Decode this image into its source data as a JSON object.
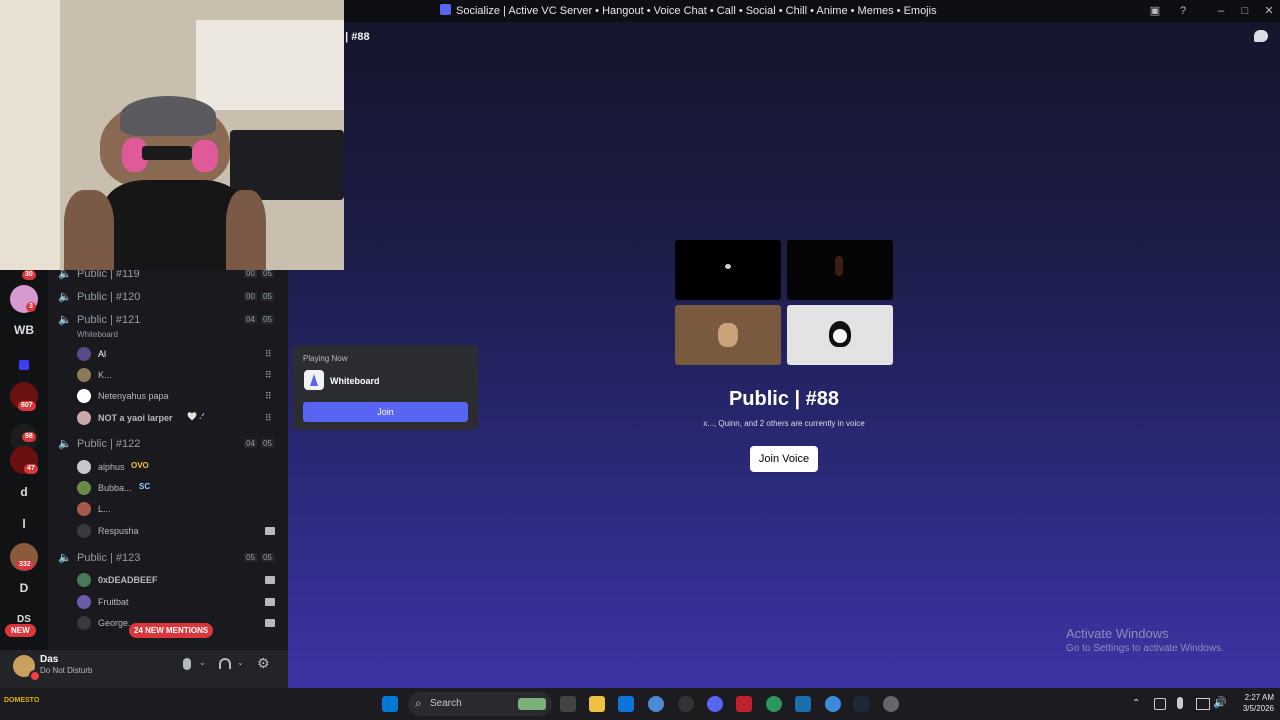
{
  "window": {
    "title": "Socialize | Active VC Server • Hangout • Voice Chat • Call • Social • Chill • Anime • Memes • Emojis"
  },
  "server_bar": {
    "items": [
      {
        "label": "",
        "badge": "30",
        "color": "#7a3b56"
      },
      {
        "label": "",
        "badge": "3",
        "color": "#d69ad0"
      },
      {
        "label": "WB",
        "badge": "",
        "color": "#111214"
      },
      {
        "label": "",
        "badge": "",
        "color": "#3b3ef0"
      },
      {
        "label": "",
        "badge": "807",
        "color": "#7a1a1a"
      },
      {
        "label": "",
        "badge": "98",
        "color": "#1c1c1c"
      },
      {
        "label": "",
        "badge": "47",
        "color": "#7a1010"
      },
      {
        "label": "d",
        "badge": "",
        "color": "#111214"
      },
      {
        "label": "l",
        "badge": "",
        "color": "#111214"
      },
      {
        "label": "",
        "badge": "332",
        "color": "#8a5a3a"
      },
      {
        "label": "D",
        "badge": "",
        "color": "#111214"
      },
      {
        "label": "DS",
        "badge": "",
        "color": "#111214"
      }
    ],
    "new_label": "NEW"
  },
  "channels": {
    "list": [
      {
        "name": "Public | #119",
        "c1": "00",
        "c2": "05",
        "active": false
      },
      {
        "name": "Public | #120",
        "c1": "00",
        "c2": "05",
        "active": false
      },
      {
        "name": "Public | #121",
        "c1": "04",
        "c2": "05",
        "active": true,
        "activity": "Whiteboard"
      },
      {
        "name": "Public | #122",
        "c1": "04",
        "c2": "05",
        "active": true
      },
      {
        "name": "Public | #123",
        "c1": "05",
        "c2": "05",
        "active": true
      }
    ],
    "members_121": [
      {
        "name": "Al",
        "tag": "",
        "color": "#5a4a8a"
      },
      {
        "name": "K...",
        "tag": "",
        "color": "#8a7a5a"
      },
      {
        "name": "Netenyahus papa",
        "tag": "",
        "color": "#ffffff"
      },
      {
        "name": "NOT a yaoi larper",
        "tag": "🤍 .ᐟ",
        "color": "#c9a8a8"
      }
    ],
    "members_122": [
      {
        "name": "alphus",
        "tag": "OVO",
        "color": "#c8c8c8"
      },
      {
        "name": "Bubba...",
        "tag": "SC",
        "color": "#6a8a4a"
      },
      {
        "name": "L...",
        "tag": "",
        "color": "#a85a4a"
      },
      {
        "name": "Respusha",
        "tag": "",
        "color": "#3a3a3a"
      }
    ],
    "members_123": [
      {
        "name": "0xDEADBEEF",
        "tag": "",
        "color": "#4a7a5a"
      },
      {
        "name": "Fruitbat",
        "tag": "",
        "color": "#6a5aa8"
      },
      {
        "name": "George...",
        "tag": "",
        "color": "#3a3a3a"
      }
    ],
    "mentions_label": "24 NEW MENTIONS"
  },
  "user": {
    "name": "Das",
    "status": "Do Not Disturb"
  },
  "main": {
    "channel_title": "c | #88",
    "voice_channel_name": "Public | #88",
    "voice_subtitle": "x..., Quinn, and 2 others are currently in voice",
    "join_voice_label": "Join Voice"
  },
  "popup": {
    "playing_label": "Playing Now",
    "app_name": "Whiteboard",
    "join_label": "Join"
  },
  "watermark": {
    "line1": "Activate Windows",
    "line2": "Go to Settings to activate Windows."
  },
  "taskbar": {
    "search_placeholder": "Search",
    "time": "2:27 AM",
    "date": "3/5/2026",
    "left_label": "DOMESTO"
  }
}
